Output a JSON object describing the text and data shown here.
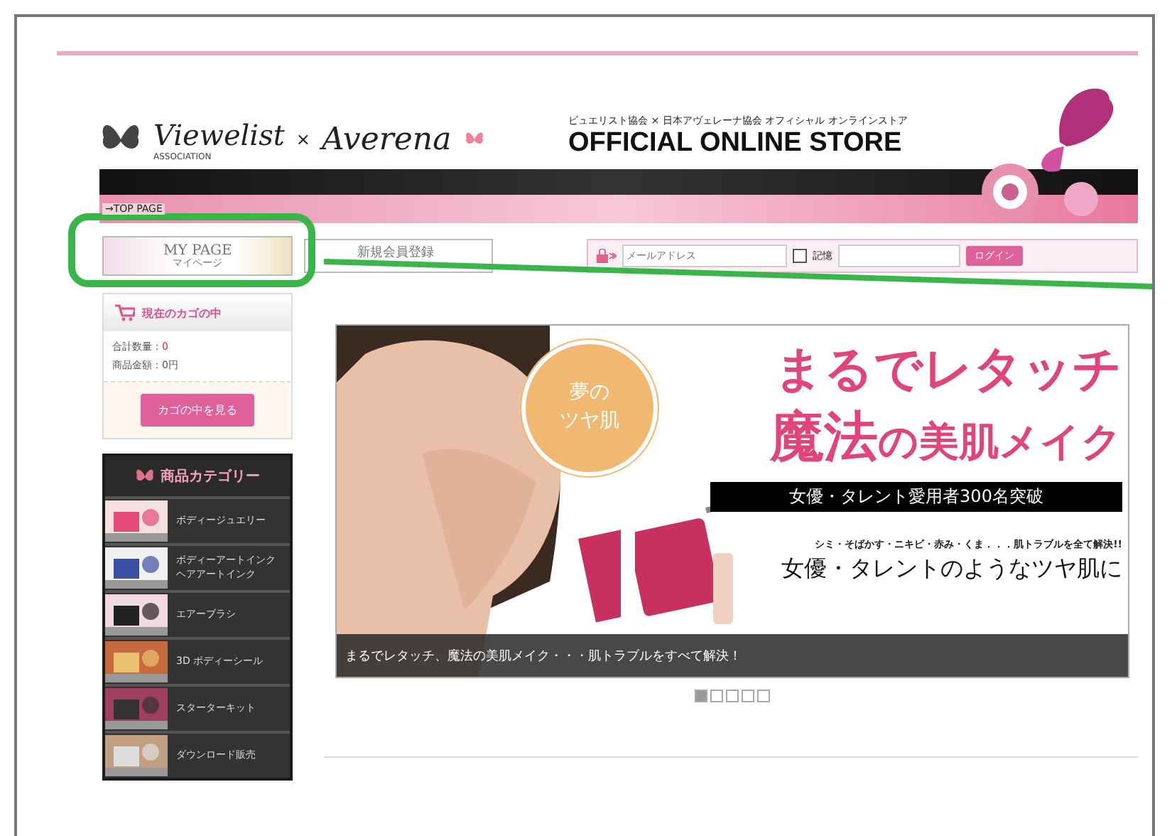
{
  "header": {
    "logo_left": "Viewelist",
    "logo_left_sub": "ASSOCIATION",
    "times": "×",
    "logo_right": "Averena",
    "tagline": "ビュエリスト協会 × 日本アヴェレーナ協会 オフィシャル オンラインストア",
    "title": "OFFICIAL ONLINE STORE",
    "top_link": "→TOP PAGE"
  },
  "nav": {
    "mypage": {
      "label": "MY PAGE",
      "sub": "マイページ"
    },
    "register": "新規会員登録",
    "login": {
      "email_placeholder": "メールアドレス",
      "remember": "記憶",
      "remember_checked": false,
      "button": "ログイン"
    }
  },
  "cart": {
    "title": "現在のカゴの中",
    "qty_label": "合計数量：",
    "qty": "0",
    "amount": "商品金額：0円",
    "button": "カゴの中を見る"
  },
  "categories": {
    "title": "商品カテゴリー",
    "items": [
      {
        "label": "ボディージュエリー",
        "kind": "picture"
      },
      {
        "label": "ボディーアートインクヘアアートインク",
        "kind": "picture"
      },
      {
        "label": "エアーブラシ",
        "kind": "picture"
      },
      {
        "label": "3D ボディーシール",
        "kind": "picture"
      },
      {
        "label": "スターターキット",
        "kind": "picture"
      },
      {
        "label": "ダウンロード販売",
        "kind": "picture"
      }
    ]
  },
  "banner": {
    "badge": [
      "夢の",
      "ツヤ肌"
    ],
    "headline_1": "まるでレタッチ",
    "headline_2a": "魔法",
    "headline_2b": "の美肌メイク",
    "bar": "女優・タレント愛用者300名突破",
    "small": "シミ・そばかす・ニキビ・赤み・くま．．．肌トラブルを全て解決!!",
    "big": "女優・タレントのようなツヤ肌に",
    "caption": "まるでレタッチ、魔法の美肌メイク・・・肌トラブルをすべて解決！"
  },
  "slides": [
    {
      "selected": true
    },
    {
      "selected": false
    },
    {
      "selected": false
    },
    {
      "selected": false
    },
    {
      "selected": false
    }
  ]
}
